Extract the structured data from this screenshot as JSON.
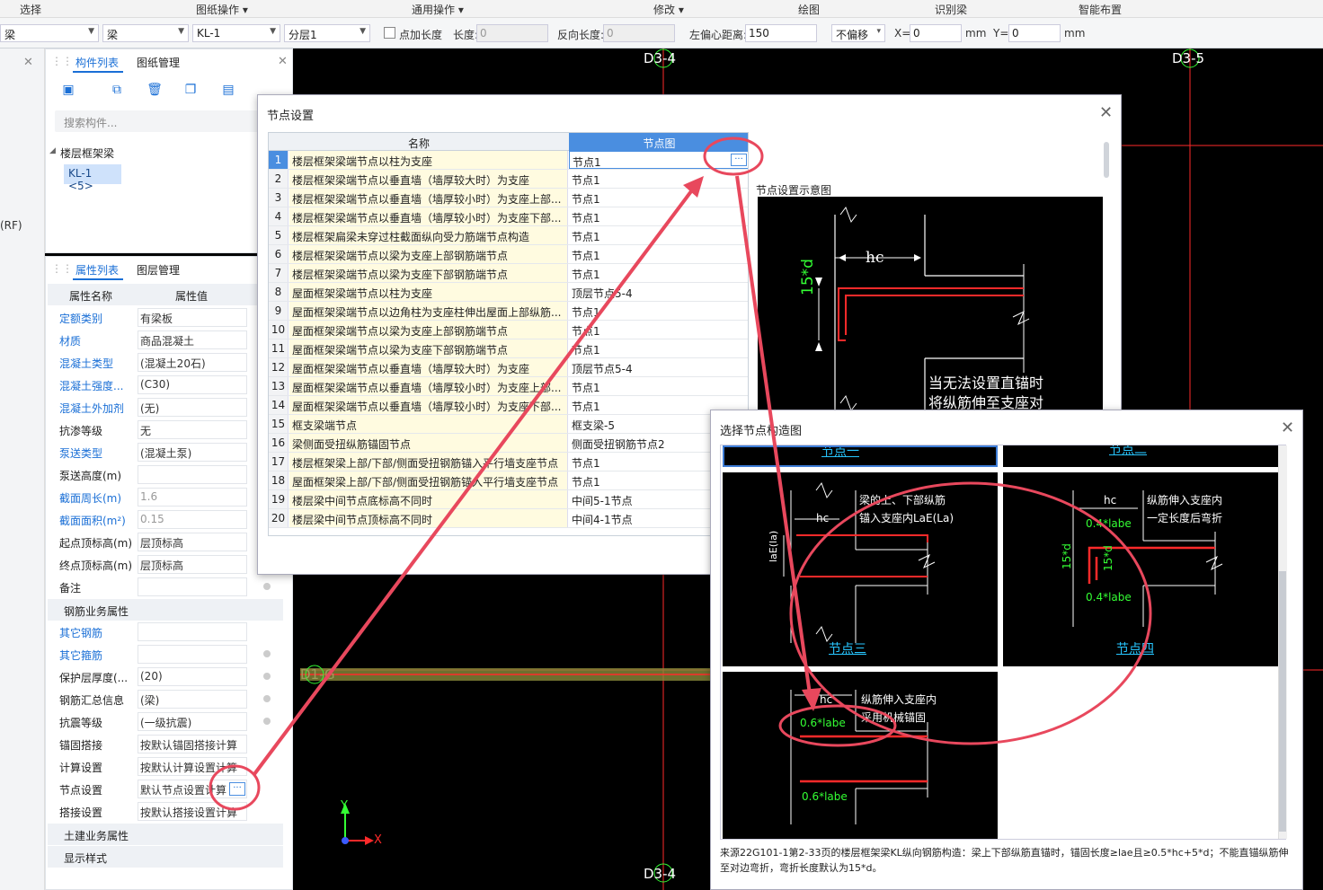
{
  "menubar": {
    "items": [
      "选择",
      "图纸操作 ▾",
      "通用操作 ▾",
      "修改 ▾",
      "绘图",
      "识别梁",
      "智能布置"
    ]
  },
  "optbar": {
    "type": "梁",
    "sub": "梁",
    "comp": "KL-1",
    "layer": "分层1",
    "add_len_label": "点加长度",
    "len_label": "长度:",
    "len_value": "0",
    "rev_len_label": "反向长度:",
    "rev_len_value": "0",
    "offset_label": "左偏心距离:",
    "offset_value": "150",
    "nooffset": "不偏移",
    "x_label": "X=",
    "x_value": "0",
    "y_label": "Y=",
    "y_value": "0",
    "unit": "mm"
  },
  "comp_panel": {
    "tab_active": "构件列表",
    "tab_other": "图纸管理",
    "search_placeholder": "搜索构件...",
    "tree_root": "楼层框架梁",
    "tree_item": "KL-1 <5>"
  },
  "prop_panel": {
    "tab_active": "属性列表",
    "tab_other": "图层管理",
    "col_name": "属性名称",
    "col_value": "属性值",
    "rows": [
      {
        "name": "定额类别",
        "value": "有梁板",
        "blue": true
      },
      {
        "name": "材质",
        "value": "商品混凝土",
        "blue": true
      },
      {
        "name": "混凝土类型",
        "value": "(混凝土20石)",
        "blue": true
      },
      {
        "name": "混凝土强度...",
        "value": "(C30)",
        "blue": true
      },
      {
        "name": "混凝土外加剂",
        "value": "(无)",
        "blue": true
      },
      {
        "name": "抗渗等级",
        "value": "无",
        "blue": false
      },
      {
        "name": "泵送类型",
        "value": "(混凝土泵)",
        "blue": true
      },
      {
        "name": "泵送高度(m)",
        "value": "",
        "blue": false
      },
      {
        "name": "截面周长(m)",
        "value": "1.6",
        "blue": true,
        "gray": true
      },
      {
        "name": "截面面积(m²)",
        "value": "0.15",
        "blue": true,
        "gray": true
      },
      {
        "name": "起点顶标高(m)",
        "value": "层顶标高",
        "blue": false
      },
      {
        "name": "终点顶标高(m)",
        "value": "层顶标高",
        "blue": false
      },
      {
        "name": "备注",
        "value": "",
        "blue": false
      }
    ],
    "group_rebar": "钢筋业务属性",
    "rebar_rows": [
      {
        "name": "其它钢筋",
        "value": "",
        "blue": true
      },
      {
        "name": "其它箍筋",
        "value": "",
        "blue": true
      },
      {
        "name": "保护层厚度(...",
        "value": "(20)",
        "blue": false
      },
      {
        "name": "钢筋汇总信息",
        "value": "(梁)",
        "blue": false
      },
      {
        "name": "抗震等级",
        "value": "(一级抗震)",
        "blue": false
      },
      {
        "name": "锚固搭接",
        "value": "按默认锚固搭接计算",
        "blue": false
      },
      {
        "name": "计算设置",
        "value": "按默认计算设置计算",
        "blue": false
      },
      {
        "name": "节点设置",
        "value": "默认节点设置计算",
        "blue": false
      },
      {
        "name": "搭接设置",
        "value": "按默认搭接设置计算",
        "blue": false
      }
    ],
    "group_civil": "土建业务属性",
    "group_display": "显示样式"
  },
  "left_strip": {
    "labels": [
      "(RF)"
    ]
  },
  "canvas": {
    "axis_top_left": "D3-4",
    "axis_top_right": "D3-5",
    "axis_bottom": "D3-4",
    "axis_mid": "D1-G",
    "x_axis": "X",
    "y_axis": "Y"
  },
  "dlg1": {
    "title": "节点设置",
    "col_name": "名称",
    "col_node": "节点图",
    "rows": [
      {
        "no": "1",
        "name": "楼层框架梁端节点以柱为支座",
        "node": "节点1"
      },
      {
        "no": "2",
        "name": "楼层框架梁端节点以垂直墙（墙厚较大时）为支座",
        "node": "节点1"
      },
      {
        "no": "3",
        "name": "楼层框架梁端节点以垂直墙（墙厚较小时）为支座上部...",
        "node": "节点1"
      },
      {
        "no": "4",
        "name": "楼层框架梁端节点以垂直墙（墙厚较小时）为支座下部...",
        "node": "节点1"
      },
      {
        "no": "5",
        "name": "楼层框架扁梁未穿过柱截面纵向受力筋端节点构造",
        "node": "节点1"
      },
      {
        "no": "6",
        "name": "楼层框架梁端节点以梁为支座上部钢筋端节点",
        "node": "节点1"
      },
      {
        "no": "7",
        "name": "楼层框架梁端节点以梁为支座下部钢筋端节点",
        "node": "节点1"
      },
      {
        "no": "8",
        "name": "屋面框架梁端节点以柱为支座",
        "node": "顶层节点5-4"
      },
      {
        "no": "9",
        "name": "屋面框架梁端节点以边角柱为支座柱伸出屋面上部纵筋...",
        "node": "节点1"
      },
      {
        "no": "10",
        "name": "屋面框架梁端节点以梁为支座上部钢筋端节点",
        "node": "节点1"
      },
      {
        "no": "11",
        "name": "屋面框架梁端节点以梁为支座下部钢筋端节点",
        "node": "节点1"
      },
      {
        "no": "12",
        "name": "屋面框架梁端节点以垂直墙（墙厚较大时）为支座",
        "node": "顶层节点5-4"
      },
      {
        "no": "13",
        "name": "屋面框架梁端节点以垂直墙（墙厚较小时）为支座上部...",
        "node": "节点1"
      },
      {
        "no": "14",
        "name": "屋面框架梁端节点以垂直墙（墙厚较小时）为支座下部...",
        "node": "节点1"
      },
      {
        "no": "15",
        "name": "框支梁端节点",
        "node": "框支梁-5"
      },
      {
        "no": "16",
        "name": "梁侧面受扭纵筋锚固节点",
        "node": "侧面受扭钢筋节点2"
      },
      {
        "no": "17",
        "name": "楼层框架梁上部/下部/侧面受扭钢筋锚入平行墙支座节点",
        "node": "节点1"
      },
      {
        "no": "18",
        "name": "屋面框架梁上部/下部/侧面受扭钢筋锚入平行墙支座节点",
        "node": "节点1"
      },
      {
        "no": "19",
        "name": "楼层梁中间节点底标高不同时",
        "node": "中间5-1节点"
      },
      {
        "no": "20",
        "name": "楼层梁中间节点顶标高不同时",
        "node": "中间4-1节点"
      }
    ],
    "diag_title": "节点设置示意图",
    "diag_hc": "hc",
    "diag_15d": "15*d",
    "diag_note1": "当无法设置直锚时",
    "diag_note2": "将纵筋伸至支座对"
  },
  "dlg2": {
    "title": "选择节点构造图",
    "top_left_cap": "节点一",
    "top_right_cap": "节点二",
    "cell3": {
      "cap": "节点三",
      "t1": "梁的上、下部纵筋",
      "t2": "锚入支座内LaE(La)",
      "hc": "hc",
      "v": "laE(la)"
    },
    "cell4": {
      "cap": "节点四",
      "t1": "纵筋伸入支座内",
      "t2": "一定长度后弯折",
      "hc": "hc",
      "a": "0.4*labe",
      "b": "0.4*labe",
      "c": "15*d",
      "d": "15*d"
    },
    "cell5": {
      "hc": "hc",
      "t1": "纵筋伸入支座内",
      "t2": "采用机械锚固",
      "a": "0.6*labe",
      "b": "0.6*labe"
    },
    "footnote": "来源22G101-1第2-33页的楼层框架梁KL纵向钢筋构造：梁上下部纵筋直锚时，锚固长度≥lae且≥0.5*hc+5*d；不能直锚纵筋伸至对边弯折，弯折长度默认为15*d。"
  },
  "colors": {
    "accent": "#1a6fd6",
    "highlight": "#e8485d",
    "cad_red": "#ff2a2a",
    "cad_green": "#34ff34",
    "cad_cyan": "#27c6ff"
  }
}
